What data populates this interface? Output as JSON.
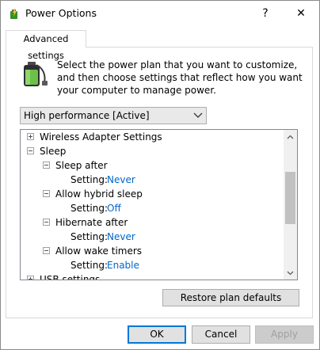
{
  "window": {
    "title": "Power Options",
    "help_label": "?",
    "close_label": "✕"
  },
  "tab": {
    "label": "Advanced settings"
  },
  "description": "Select the power plan that you want to customize, and then choose settings that reflect how you want your computer to manage power.",
  "plan": {
    "selected": "High performance [Active]"
  },
  "tree": {
    "wireless": "Wireless Adapter Settings",
    "sleep": "Sleep",
    "sleep_after": {
      "label": "Sleep after",
      "setting_label": "Setting:",
      "value": "Never"
    },
    "hybrid_sleep": {
      "label": "Allow hybrid sleep",
      "setting_label": "Setting:",
      "value": "Off"
    },
    "hibernate_after": {
      "label": "Hibernate after",
      "setting_label": "Setting:",
      "value": "Never"
    },
    "wake_timers": {
      "label": "Allow wake timers",
      "setting_label": "Setting:",
      "value": "Enable"
    },
    "usb": "USB settings"
  },
  "buttons": {
    "restore": "Restore plan defaults",
    "ok": "OK",
    "cancel": "Cancel",
    "apply": "Apply"
  },
  "colors": {
    "setting_value": "#0066cc",
    "focus_border": "#0078d7"
  }
}
